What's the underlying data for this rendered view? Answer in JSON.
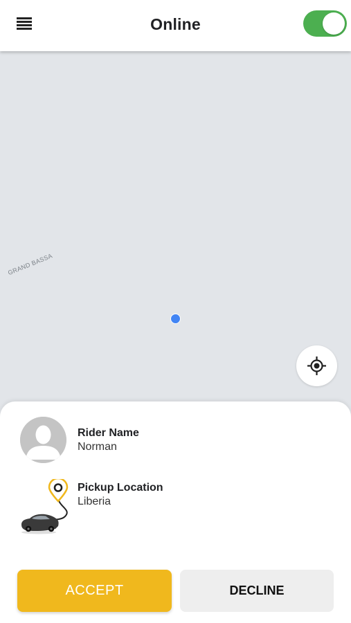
{
  "header": {
    "title": "Online",
    "menu_icon": "hamburger-menu-icon",
    "online_toggle": {
      "state": "on",
      "color": "#4caf50"
    }
  },
  "map": {
    "region_label": "GRAND BASSA",
    "location_dot_color": "#4285f4",
    "recenter_icon": "crosshair-icon"
  },
  "ride_request": {
    "rider_name_label": "Rider Name",
    "rider_name": "Norman",
    "pickup_location_label": "Pickup Location",
    "pickup_location": "Liberia",
    "avatar_icon": "person-avatar-icon",
    "route_icon": "car-route-pin-icon"
  },
  "actions": {
    "accept_label": "ACCEPT",
    "decline_label": "DECLINE",
    "accept_color": "#f0b81d",
    "decline_color": "#eeeeee"
  }
}
